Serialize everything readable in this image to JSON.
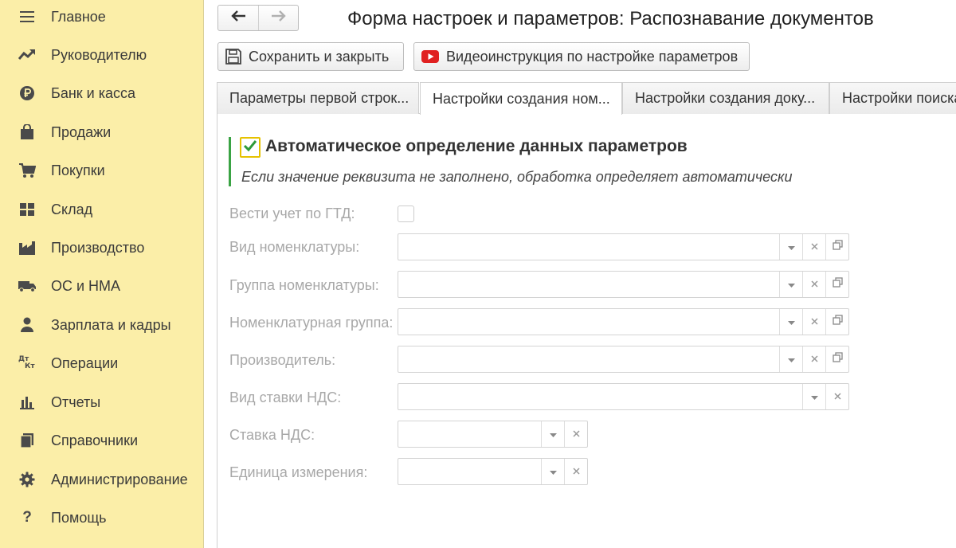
{
  "sidebar": {
    "items": [
      {
        "label": "Главное",
        "icon": "menu-lines-icon"
      },
      {
        "label": "Руководителю",
        "icon": "trend-chart-icon"
      },
      {
        "label": "Банк и касса",
        "icon": "ruble-coin-icon"
      },
      {
        "label": "Продажи",
        "icon": "shopping-bag-icon"
      },
      {
        "label": "Покупки",
        "icon": "shopping-cart-icon"
      },
      {
        "label": "Склад",
        "icon": "warehouse-grid-icon"
      },
      {
        "label": "Производство",
        "icon": "factory-icon"
      },
      {
        "label": "ОС и НМА",
        "icon": "truck-icon"
      },
      {
        "label": "Зарплата и кадры",
        "icon": "person-icon"
      },
      {
        "label": "Операции",
        "icon": "debit-credit-icon",
        "glyph_top": "Дт",
        "glyph_bottom": "Кт"
      },
      {
        "label": "Отчеты",
        "icon": "bar-chart-icon"
      },
      {
        "label": "Справочники",
        "icon": "books-icon"
      },
      {
        "label": "Администрирование",
        "icon": "gear-icon"
      },
      {
        "label": "Помощь",
        "icon": "question-icon",
        "glyph": "?"
      }
    ]
  },
  "header": {
    "title": "Форма настроек и параметров: Распознавание документов"
  },
  "toolbar": {
    "save_label": "Сохранить и закрыть",
    "video_label": "Видеоинструкция по настройке параметров"
  },
  "tabs": [
    {
      "label": "Параметры первой строк...",
      "active": false
    },
    {
      "label": "Настройки создания ном...",
      "active": true
    },
    {
      "label": "Настройки создания доку...",
      "active": false
    },
    {
      "label": "Настройки поиска",
      "active": false
    }
  ],
  "group": {
    "title": "Автоматическое определение данных параметров",
    "hint": "Если значение реквизита не заполнено, обработка определяет автоматически",
    "checked": true
  },
  "fields": {
    "gtd": {
      "label": "Вести учет по ГТД:",
      "checked": false
    },
    "nomenclature_type": {
      "label": "Вид номенклатуры:",
      "value": ""
    },
    "nomenclature_group": {
      "label": "Группа номенклатуры:",
      "value": ""
    },
    "item_group": {
      "label": "Номенклатурная группа:",
      "value": ""
    },
    "manufacturer": {
      "label": "Производитель:",
      "value": ""
    },
    "vat_rate_type": {
      "label": "Вид ставки НДС:",
      "value": ""
    },
    "vat_rate": {
      "label": "Ставка НДС:",
      "value": ""
    },
    "unit": {
      "label": "Единица измерения:",
      "value": ""
    }
  },
  "colors": {
    "sidebar_bg": "#fbeea8",
    "accent_green": "#3aa344",
    "checkbox_border": "#e6c200",
    "youtube_red": "#e02020",
    "disabled_text": "#a8a8a8"
  }
}
